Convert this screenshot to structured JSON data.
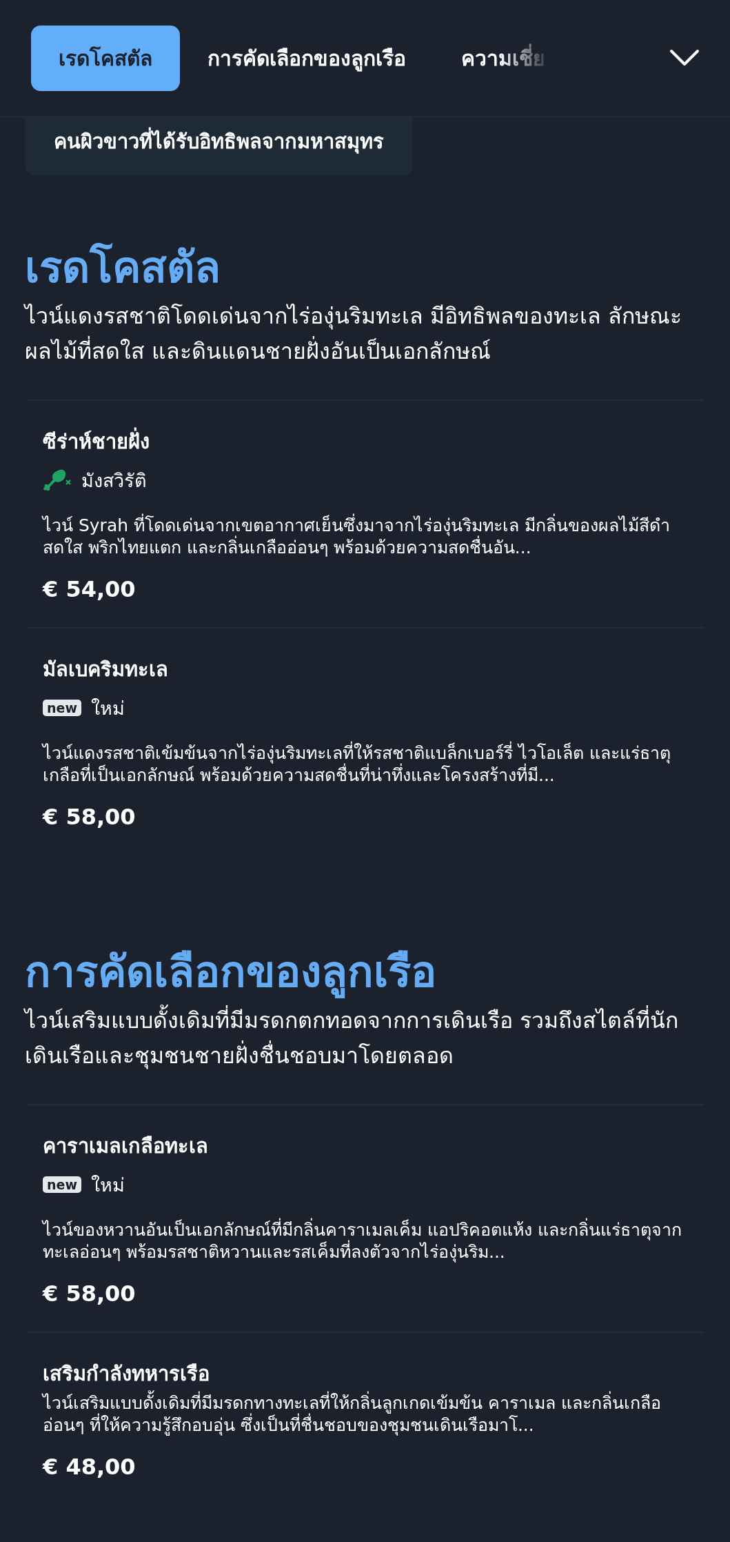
{
  "tabs": [
    {
      "label": "เรดโคสตัล",
      "selected": true
    },
    {
      "label": "การคัดเลือกของลูกเรือ",
      "selected": false
    },
    {
      "label": "ความเชี่ย",
      "selected": false
    }
  ],
  "chip": {
    "label": "คนผิวขาวที่ได้รับอิทธิพลจากมหาสมุทร"
  },
  "sections": [
    {
      "title": "เรดโคสตัล",
      "description": "ไวน์แดงรสชาติโดดเด่นจากไร่องุ่นริมทะเล มีอิทธิพลของทะเล ลักษณะผลไม้ที่สดใส และดินแดนชายฝั่งอันเป็นเอกลักษณ์",
      "items": [
        {
          "name": "ซีร่าห์ชายฝั่ง",
          "tag": {
            "kind": "vegetarian",
            "label": "มังสวิรัติ"
          },
          "description": "ไวน์ Syrah ที่โดดเด่นจากเขตอากาศเย็นซึ่งมาจากไร่องุ่นริมทะเล มีกลิ่นของผลไม้สีดำสดใส พริกไทยแตก และกลิ่นเกลืออ่อนๆ พร้อมด้วยความสดชื่นอัน...",
          "price": "€ 54,00"
        },
        {
          "name": "มัลเบคริมทะเล",
          "tag": {
            "kind": "new",
            "badge": "new",
            "label": "ใหม่"
          },
          "description": "ไวน์แดงรสชาติเข้มข้นจากไร่องุ่นริมทะเลที่ให้รสชาติแบล็กเบอร์รี่ ไวโอเล็ต และแร่ธาตุเกลือที่เป็นเอกลักษณ์ พร้อมด้วยความสดชื่นที่น่าทึ่งและโครงสร้างที่มี...",
          "price": "€ 58,00"
        }
      ]
    },
    {
      "title": "การคัดเลือกของลูกเรือ",
      "description": "ไวน์เสริมแบบดั้งเดิมที่มีมรดกตกทอดจากการเดินเรือ รวมถึงสไตล์ที่นักเดินเรือและชุมชนชายฝั่งชื่นชอบมาโดยตลอด",
      "items": [
        {
          "name": "คาราเมลเกลือทะเล",
          "tag": {
            "kind": "new",
            "badge": "new",
            "label": "ใหม่"
          },
          "description": "ไวน์ของหวานอันเป็นเอกลักษณ์ที่มีกลิ่นคาราเมลเค็ม แอปริคอตแห้ง และกลิ่นแร่ธาตุจากทะเลอ่อนๆ พร้อมรสชาติหวานและรสเค็มที่ลงตัวจากไร่องุ่นริม...",
          "price": "€ 58,00"
        },
        {
          "name": "เสริมกำลังทหารเรือ",
          "description": "ไวน์เสริมแบบดั้งเดิมที่มีมรดกทางทะเลที่ให้กลิ่นลูกเกดเข้มข้น คาราเมล และกลิ่นเกลืออ่อนๆ ที่ให้ความรู้สึกอบอุ่น ซึ่งเป็นที่ชื่นชอบของชุมชนเดินเรือมาโ...",
          "price": "€ 48,00"
        }
      ]
    }
  ]
}
